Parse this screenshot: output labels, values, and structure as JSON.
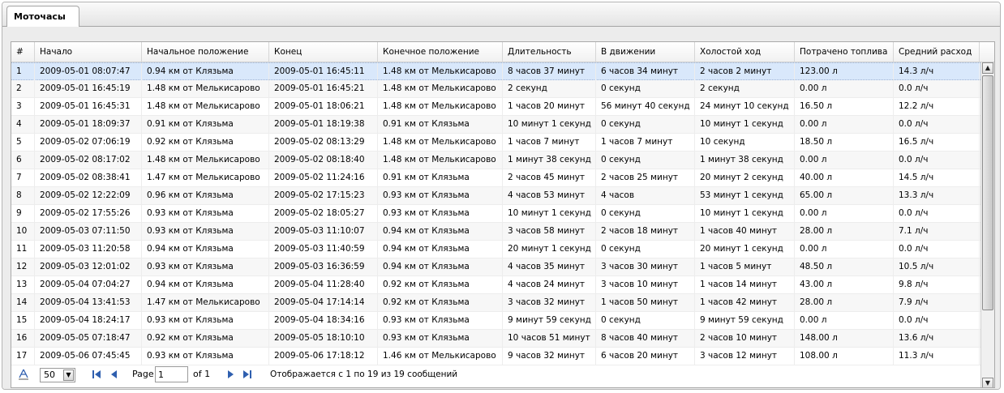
{
  "tab": {
    "label": "Моточасы"
  },
  "columns": [
    "#",
    "Начало",
    "Начальное положение",
    "Конец",
    "Конечное положение",
    "Длительность",
    "В движении",
    "Холостой ход",
    "Потрачено топлива",
    "Средний расход"
  ],
  "rows": [
    [
      "1",
      "2009-05-01 08:07:47",
      "0.94 км от Клязьма",
      "2009-05-01 16:45:11",
      "1.48 км от Мелькисарово",
      "8 часов 37 минут",
      "6 часов 34 минут",
      "2 часов 2 минут",
      "123.00 л",
      "14.3 л/ч"
    ],
    [
      "2",
      "2009-05-01 16:45:19",
      "1.48 км от Мелькисарово",
      "2009-05-01 16:45:21",
      "1.48 км от Мелькисарово",
      "2 секунд",
      "0 секунд",
      "2 секунд",
      "0.00 л",
      "0.0 л/ч"
    ],
    [
      "3",
      "2009-05-01 16:45:31",
      "1.48 км от Мелькисарово",
      "2009-05-01 18:06:21",
      "1.48 км от Мелькисарово",
      "1 часов 20 минут",
      "56 минут 40 секунд",
      "24 минут 10 секунд",
      "16.50 л",
      "12.2 л/ч"
    ],
    [
      "4",
      "2009-05-01 18:09:37",
      "0.91 км от Клязьма",
      "2009-05-01 18:19:38",
      "0.91 км от Клязьма",
      "10 минут 1 секунд",
      "0 секунд",
      "10 минут 1 секунд",
      "0.00 л",
      "0.0 л/ч"
    ],
    [
      "5",
      "2009-05-02 07:06:19",
      "0.92 км от Клязьма",
      "2009-05-02 08:13:29",
      "1.48 км от Мелькисарово",
      "1 часов 7 минут",
      "1 часов 7 минут",
      "10 секунд",
      "18.50 л",
      "16.5 л/ч"
    ],
    [
      "6",
      "2009-05-02 08:17:02",
      "1.48 км от Мелькисарово",
      "2009-05-02 08:18:40",
      "1.48 км от Мелькисарово",
      "1 минут 38 секунд",
      "0 секунд",
      "1 минут 38 секунд",
      "0.00 л",
      "0.0 л/ч"
    ],
    [
      "7",
      "2009-05-02 08:38:41",
      "1.47 км от Мелькисарово",
      "2009-05-02 11:24:16",
      "0.91 км от Клязьма",
      "2 часов 45 минут",
      "2 часов 25 минут",
      "20 минут 2 секунд",
      "40.00 л",
      "14.5 л/ч"
    ],
    [
      "8",
      "2009-05-02 12:22:09",
      "0.96 км от Клязьма",
      "2009-05-02 17:15:23",
      "0.93 км от Клязьма",
      "4 часов 53 минут",
      "4 часов",
      "53 минут 1 секунд",
      "65.00 л",
      "13.3 л/ч"
    ],
    [
      "9",
      "2009-05-02 17:55:26",
      "0.93 км от Клязьма",
      "2009-05-02 18:05:27",
      "0.93 км от Клязьма",
      "10 минут 1 секунд",
      "0 секунд",
      "10 минут 1 секунд",
      "0.00 л",
      "0.0 л/ч"
    ],
    [
      "10",
      "2009-05-03 07:11:50",
      "0.93 км от Клязьма",
      "2009-05-03 11:10:07",
      "0.94 км от Клязьма",
      "3 часов 58 минут",
      "2 часов 18 минут",
      "1 часов 40 минут",
      "28.00 л",
      "7.1 л/ч"
    ],
    [
      "11",
      "2009-05-03 11:20:58",
      "0.94 км от Клязьма",
      "2009-05-03 11:40:59",
      "0.94 км от Клязьма",
      "20 минут 1 секунд",
      "0 секунд",
      "20 минут 1 секунд",
      "0.00 л",
      "0.0 л/ч"
    ],
    [
      "12",
      "2009-05-03 12:01:02",
      "0.93 км от Клязьма",
      "2009-05-03 16:36:59",
      "0.94 км от Клязьма",
      "4 часов 35 минут",
      "3 часов 30 минут",
      "1 часов 5 минут",
      "48.50 л",
      "10.5 л/ч"
    ],
    [
      "13",
      "2009-05-04 07:04:27",
      "0.94 км от Клязьма",
      "2009-05-04 11:28:40",
      "0.92 км от Клязьма",
      "4 часов 24 минут",
      "3 часов 10 минут",
      "1 часов 14 минут",
      "43.00 л",
      "9.8 л/ч"
    ],
    [
      "14",
      "2009-05-04 13:41:53",
      "1.47 км от Мелькисарово",
      "2009-05-04 17:14:14",
      "0.92 км от Клязьма",
      "3 часов 32 минут",
      "1 часов 50 минут",
      "1 часов 42 минут",
      "28.00 л",
      "7.9 л/ч"
    ],
    [
      "15",
      "2009-05-04 18:24:17",
      "0.93 км от Клязьма",
      "2009-05-04 18:34:16",
      "0.93 км от Клязьма",
      "9 минут 59 секунд",
      "0 секунд",
      "9 минут 59 секунд",
      "0.00 л",
      "0.0 л/ч"
    ],
    [
      "16",
      "2009-05-05 07:18:47",
      "0.92 км от Клязьма",
      "2009-05-05 18:10:10",
      "0.93 км от Клязьма",
      "10 часов 51 минут",
      "8 часов 40 минут",
      "2 часов 10 минут",
      "148.00 л",
      "13.6 л/ч"
    ],
    [
      "17",
      "2009-05-06 07:45:45",
      "0.93 км от Клязьма",
      "2009-05-06 17:18:12",
      "1.46 км от Мелькисарово",
      "9 часов 32 минут",
      "6 часов 20 минут",
      "3 часов 12 минут",
      "108.00 л",
      "11.3 л/ч"
    ]
  ],
  "paging": {
    "page_size": "50",
    "page_label": "Page",
    "page_value": "1",
    "of_label": "of 1",
    "status": "Отображается с 1 по 19 из 19 сообщений"
  },
  "colors": {
    "selected_row": "#d9e8fb",
    "nav_blue": "#2f5faf"
  }
}
